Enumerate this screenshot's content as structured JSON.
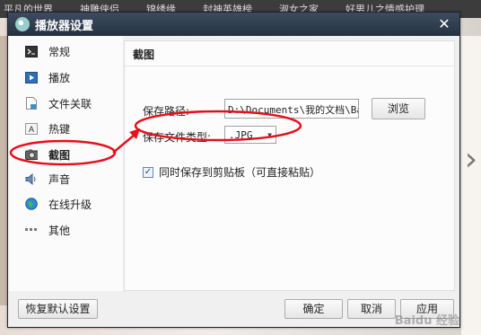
{
  "background": {
    "nav_items": [
      "平凡的世界",
      "神雕侠侣",
      "锦绣缘",
      "封神英雄榜",
      "淑女之家",
      "好男儿之情感护理"
    ]
  },
  "dialog": {
    "title": "播放器设置",
    "close_symbol": "✕"
  },
  "sidebar": {
    "items": [
      {
        "label": "常规",
        "icon": "console-icon",
        "selected": false
      },
      {
        "label": "播放",
        "icon": "play-icon",
        "selected": false
      },
      {
        "label": "文件关联",
        "icon": "file-icon",
        "selected": false
      },
      {
        "label": "热键",
        "icon": "key-icon",
        "selected": false
      },
      {
        "label": "截图",
        "icon": "camera-icon",
        "selected": true
      },
      {
        "label": "声音",
        "icon": "speaker-icon",
        "selected": false
      },
      {
        "label": "在线升级",
        "icon": "globe-icon",
        "selected": false
      },
      {
        "label": "其他",
        "icon": "more-icon",
        "selected": false
      }
    ]
  },
  "screenshot_panel": {
    "title": "截图",
    "save_path_label": "保存路径:",
    "save_path_value": "D:\\Documents\\我的文档\\Ba",
    "browse_label": "浏览",
    "file_type_label": "保存文件类型:",
    "file_type_value": ".JPG",
    "clipboard_label": "同时保存到剪贴板（可直接粘贴）",
    "clipboard_checked": true
  },
  "footer": {
    "restore_label": "恢复默认设置",
    "ok_label": "确定",
    "cancel_label": "取消",
    "apply_label": "应用"
  },
  "watermark": "Baidu 经验",
  "colors": {
    "titlebar": "#2f3b4d",
    "annotation": "#e5101c",
    "checkbox": "#5a86c9"
  }
}
